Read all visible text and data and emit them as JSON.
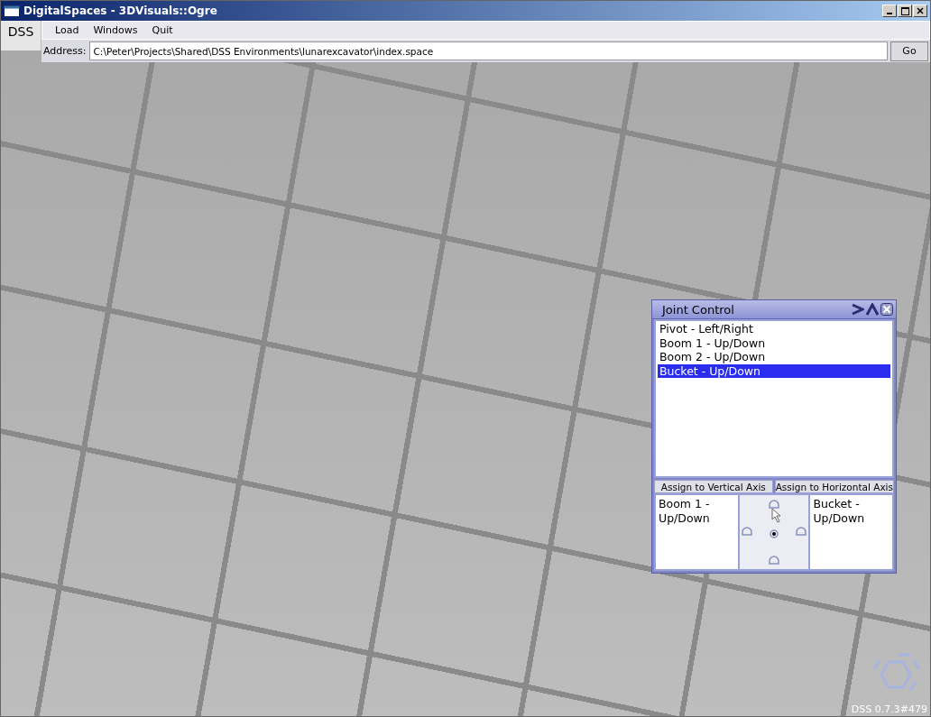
{
  "window": {
    "title": "DigitalSpaces - 3DVisuals::Ogre"
  },
  "dss_button": "DSS",
  "menu": [
    "Load",
    "Windows",
    "Quit"
  ],
  "address": {
    "label": "Address:",
    "value": "C:\\Peter\\Projects\\Shared\\DSS Environments\\lunarexcavator\\index.space",
    "go": "Go"
  },
  "joint_control": {
    "title": "Joint Control",
    "items": [
      {
        "label": "Pivot - Left/Right",
        "selected": false
      },
      {
        "label": "Boom 1 - Up/Down",
        "selected": false
      },
      {
        "label": "Boom 2 - Up/Down",
        "selected": false
      },
      {
        "label": "Bucket - Up/Down",
        "selected": true
      }
    ],
    "assign_buttons": [
      "Assign to Vertical Axis",
      "Assign to Horizontal Axis"
    ],
    "vertical_axis": "Boom 1 - Up/Down",
    "horizontal_axis": "Bucket - Up/Down"
  },
  "version": "DSS 0.7.3#479"
}
